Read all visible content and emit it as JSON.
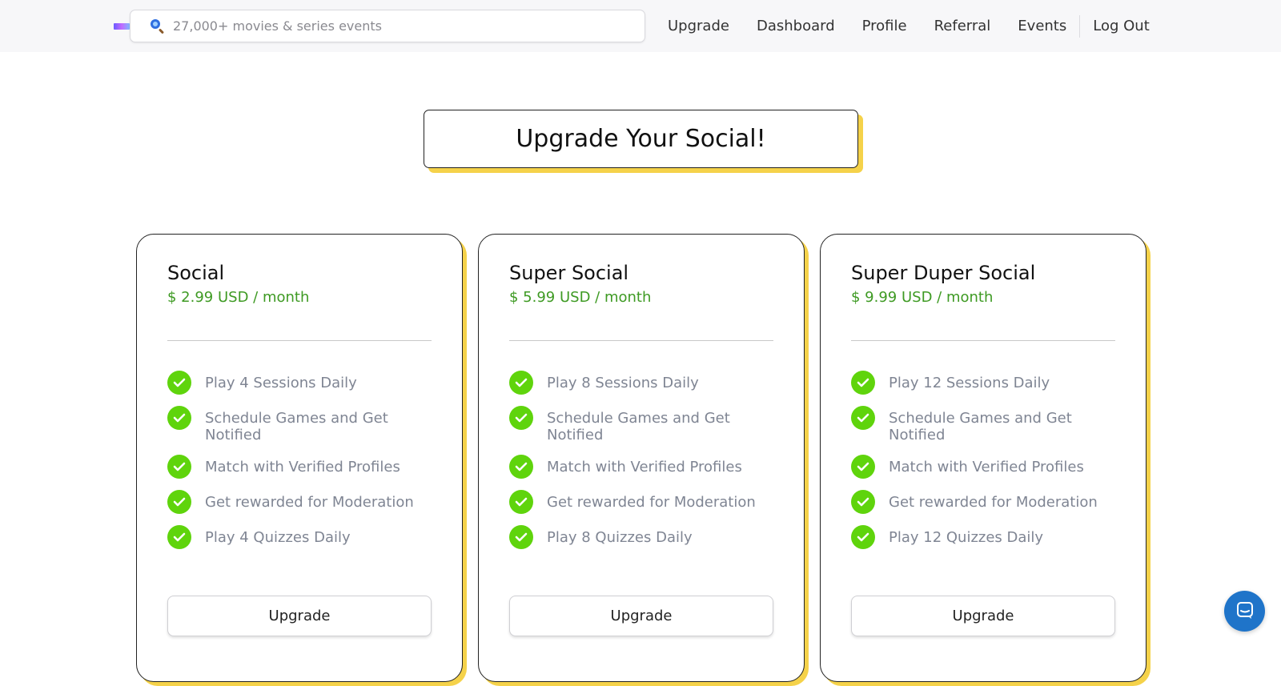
{
  "header": {
    "search": {
      "placeholder": "27,000+ movies & series events",
      "value": ""
    },
    "nav": [
      {
        "label": "Upgrade"
      },
      {
        "label": "Dashboard"
      },
      {
        "label": "Profile"
      },
      {
        "label": "Referral"
      },
      {
        "label": "Events"
      }
    ],
    "logout_label": "Log Out"
  },
  "main": {
    "title": "Upgrade Your Social!",
    "plans": [
      {
        "name": "Social",
        "price": "$ 2.99 USD / month",
        "features": [
          "Play 4 Sessions Daily",
          "Schedule Games and Get Notified",
          "Match with Verified Profiles",
          "Get rewarded for Moderation",
          "Play 4 Quizzes Daily"
        ],
        "button_label": "Upgrade"
      },
      {
        "name": "Super Social",
        "price": "$ 5.99 USD / month",
        "features": [
          "Play 8 Sessions Daily",
          "Schedule Games and Get Notified",
          "Match with Verified Profiles",
          "Get rewarded for Moderation",
          "Play 8 Quizzes Daily"
        ],
        "button_label": "Upgrade"
      },
      {
        "name": "Super Duper Social",
        "price": "$ 9.99 USD / month",
        "features": [
          "Play 12 Sessions Daily",
          "Schedule Games and Get Notified",
          "Match with Verified Profiles",
          "Get rewarded for Moderation",
          "Play 12 Quizzes Daily"
        ],
        "button_label": "Upgrade"
      }
    ]
  },
  "colors": {
    "accent_shadow": "#f5d24a",
    "price_green": "#3e9a23",
    "check_green": "#5fd40c",
    "chat_blue": "#1f74c9"
  },
  "icons": {
    "search": "search-icon",
    "check": "check-icon",
    "chat": "chat-icon",
    "logo": "logo-icon"
  }
}
